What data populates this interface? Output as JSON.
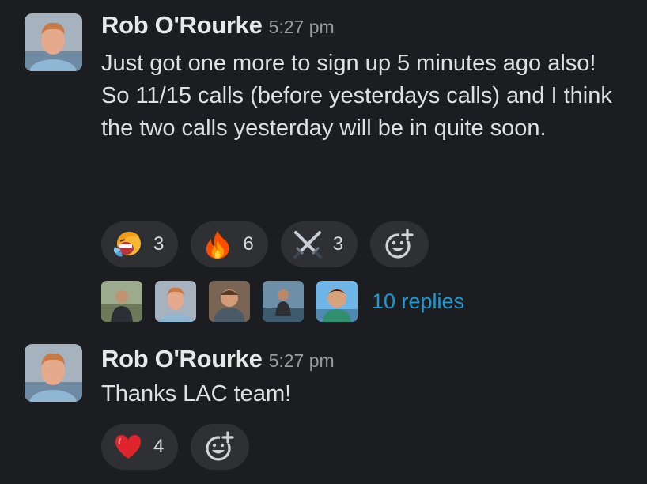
{
  "messages": [
    {
      "author": "Rob O'Rourke",
      "time": "5:27 pm",
      "text": "Just got one more to sign up 5 minutes ago also!\nSo 11/15 calls (before yesterdays calls) and I think the two calls yesterday will be in quite soon.",
      "reactions": [
        {
          "icon": "shouting-face-icon",
          "count": "3"
        },
        {
          "icon": "fire-icon",
          "count": "6"
        },
        {
          "icon": "crossed-swords-icon",
          "count": "3"
        }
      ],
      "thread": {
        "reply_label": "10 replies"
      }
    },
    {
      "author": "Rob O'Rourke",
      "time": "5:27 pm",
      "text": "Thanks LAC team!",
      "reactions": [
        {
          "icon": "red-heart-icon",
          "count": "4"
        }
      ]
    }
  ]
}
